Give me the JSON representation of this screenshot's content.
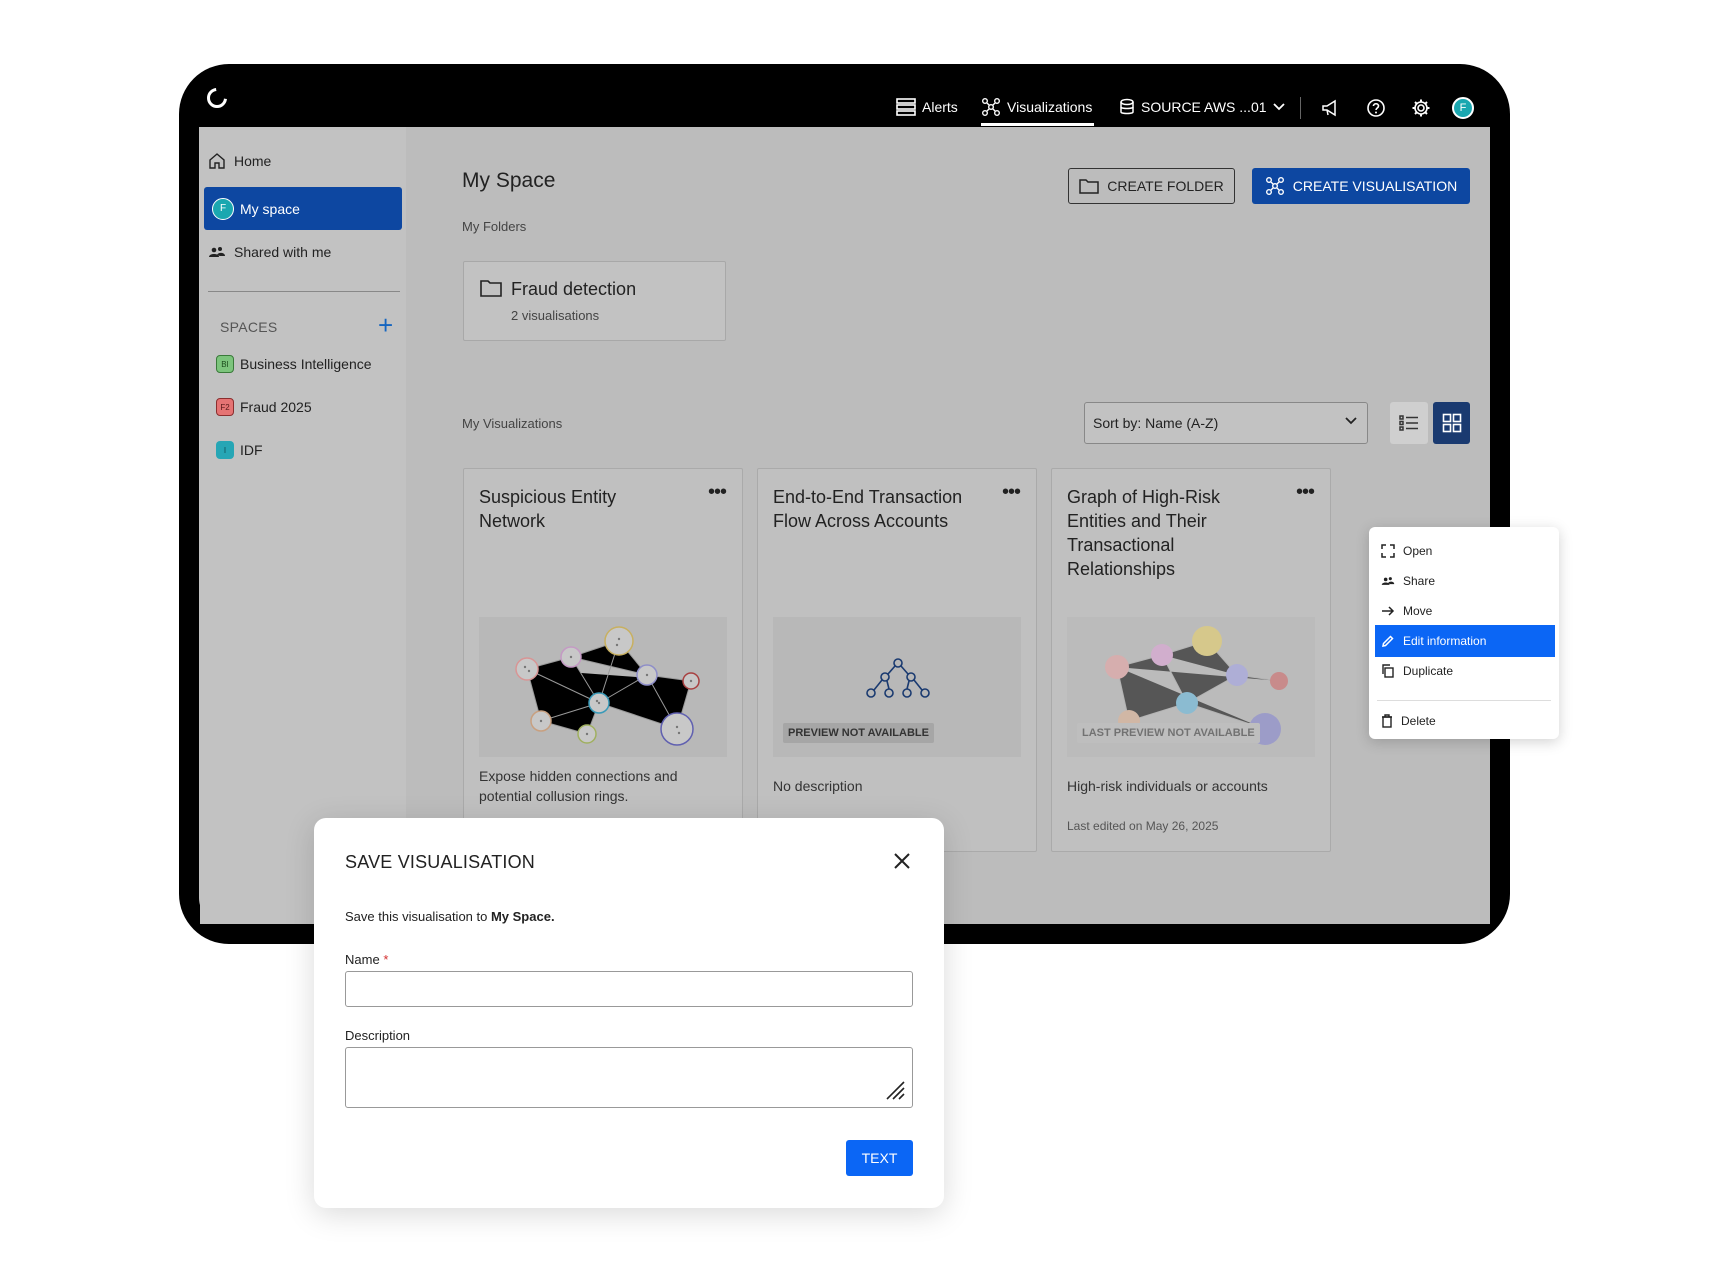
{
  "topbar": {
    "alerts": "Alerts",
    "visualizations": "Visualizations",
    "source": "SOURCE AWS ...01",
    "user_initial": "F"
  },
  "sidebar": {
    "home": "Home",
    "my_space": "My space",
    "my_space_initial": "F",
    "shared": "Shared with me",
    "spaces_label": "SPACES",
    "spaces": [
      {
        "badge": "BI",
        "label": "Business Intelligence",
        "color": "#7cc47c"
      },
      {
        "badge": "F2",
        "label": "Fraud 2025",
        "color": "#e57373"
      },
      {
        "badge": "I",
        "label": "IDF",
        "color": "#26a6b5"
      }
    ]
  },
  "main": {
    "title": "My Space",
    "my_folders": "My Folders",
    "create_folder": "CREATE FOLDER",
    "create_visualisation": "CREATE VISUALISATION",
    "folder": {
      "name": "Fraud detection",
      "count": "2 visualisations"
    },
    "my_visualizations": "My Visualizations",
    "sort": "Sort by: Name (A-Z)",
    "cards": [
      {
        "title": "Suspicious Entity Network",
        "desc": "Expose hidden connections and potential collusion rings.",
        "badge": "",
        "date": ""
      },
      {
        "title": "End-to-End Transaction Flow Across Accounts",
        "desc": "No description",
        "badge": "PREVIEW NOT AVAILABLE",
        "date": ""
      },
      {
        "title": "Graph of High-Risk Entities and Their Transactional Relationships",
        "desc": "High-risk individuals or accounts",
        "badge": "LAST PREVIEW NOT AVAILABLE",
        "date": "Last edited on May 26, 2025"
      }
    ]
  },
  "menu": {
    "items": [
      "Open",
      "Share",
      "Move",
      "Edit information",
      "Duplicate",
      "Delete"
    ]
  },
  "modal": {
    "title": "SAVE VISUALISATION",
    "text_prefix": "Save this visualisation to ",
    "text_bold": "My Space.",
    "name_label": "Name",
    "required_mark": "*",
    "name_value": "",
    "description_label": "Description",
    "description_value": "",
    "button": "TEXT"
  },
  "colors": {
    "primary_dark": "#0d47a1",
    "primary": "#0b66f5",
    "teal": "#1aa7b0"
  }
}
